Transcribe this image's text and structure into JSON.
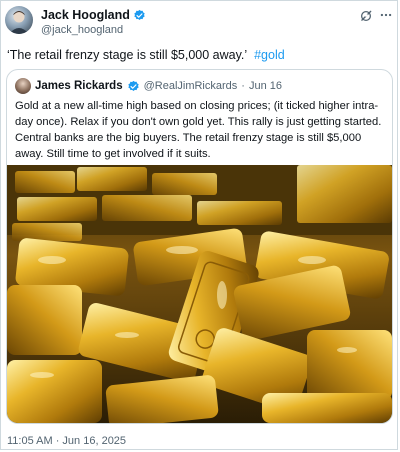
{
  "author": {
    "name": "Jack Hoogland",
    "handle": "@jack_hoogland"
  },
  "tweet": {
    "text": "‘The retail frenzy stage is still $5,000 away.’",
    "hashtag": "#gold",
    "timestamp": "11:05 AM · Jun 16, 2025"
  },
  "quoted_tweet": {
    "name": "James Rickards",
    "handle": "@RealJimRickards",
    "separator": "·",
    "date": "Jun 16",
    "text": "Gold at a new all-time high based on closing prices; (it ticked higher intra-day once). Relax if you don't own gold yet. This rally is just getting started. Central banks are the big buyers. The retail frenzy stage is still $5,000 away. Still time to get involved if it suits.",
    "image_alt": "gold bars"
  },
  "icons": {
    "verified": "verified-badge-icon",
    "grok": "grok-icon",
    "more": "more-options-icon"
  },
  "colors": {
    "link": "#1d9bf0",
    "secondary_text": "#536471",
    "border": "#cfd9de",
    "gold": "#d4a017"
  }
}
